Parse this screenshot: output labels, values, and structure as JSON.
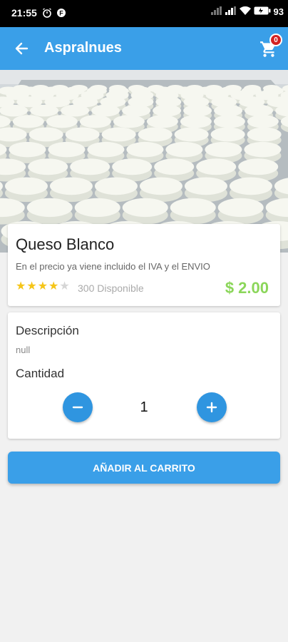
{
  "status_bar": {
    "time": "21:55",
    "battery": "93"
  },
  "app_bar": {
    "title": "Aspralnues",
    "cart_count": "0"
  },
  "product": {
    "name": "Queso Blanco",
    "note": "En el precio ya viene incluido el IVA y el ENVIO",
    "rating": 4,
    "rating_max": 5,
    "stock": "300 Disponible",
    "price": "$ 2.00"
  },
  "details": {
    "description_label": "Descripción",
    "description_value": "null",
    "quantity_label": "Cantidad",
    "quantity": "1"
  },
  "actions": {
    "add_to_cart_label": "AÑADIR AL CARRITO"
  },
  "colors": {
    "primary": "#3a9fe8",
    "price": "#8bd65a",
    "star_on": "#f5c518",
    "star_off": "#d6d6d6",
    "badge": "#d32222"
  },
  "icons": [
    "alarm-icon",
    "app-icon",
    "signal-icon",
    "wifi-icon",
    "battery-icon",
    "back-arrow-icon",
    "cart-icon",
    "star-icon",
    "minus-icon",
    "plus-icon"
  ]
}
